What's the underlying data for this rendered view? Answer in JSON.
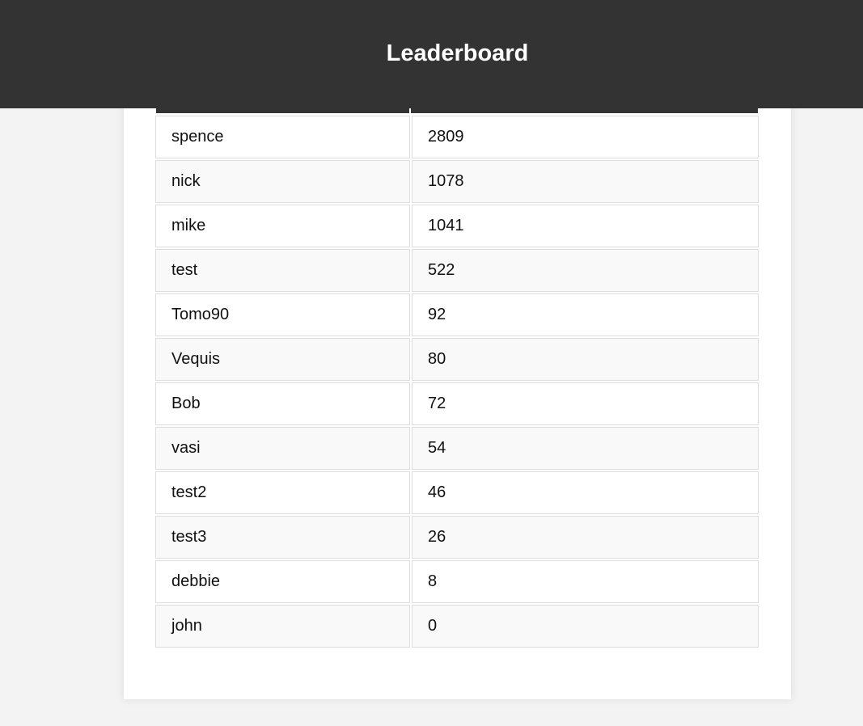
{
  "header": {
    "title": "Leaderboard"
  },
  "leaderboard": {
    "rows": [
      {
        "name": "spence",
        "score": "2809"
      },
      {
        "name": "nick",
        "score": "1078"
      },
      {
        "name": "mike",
        "score": "1041"
      },
      {
        "name": "test",
        "score": "522"
      },
      {
        "name": "Tomo90",
        "score": "92"
      },
      {
        "name": "Vequis",
        "score": "80"
      },
      {
        "name": "Bob",
        "score": "72"
      },
      {
        "name": "vasi",
        "score": "54"
      },
      {
        "name": "test2",
        "score": "46"
      },
      {
        "name": "test3",
        "score": "26"
      },
      {
        "name": "debbie",
        "score": "8"
      },
      {
        "name": "john",
        "score": "0"
      }
    ]
  },
  "colors": {
    "header_bg": "#333333",
    "page_bg": "#f3f3f3",
    "row_alt_bg": "#f9f9f9"
  }
}
